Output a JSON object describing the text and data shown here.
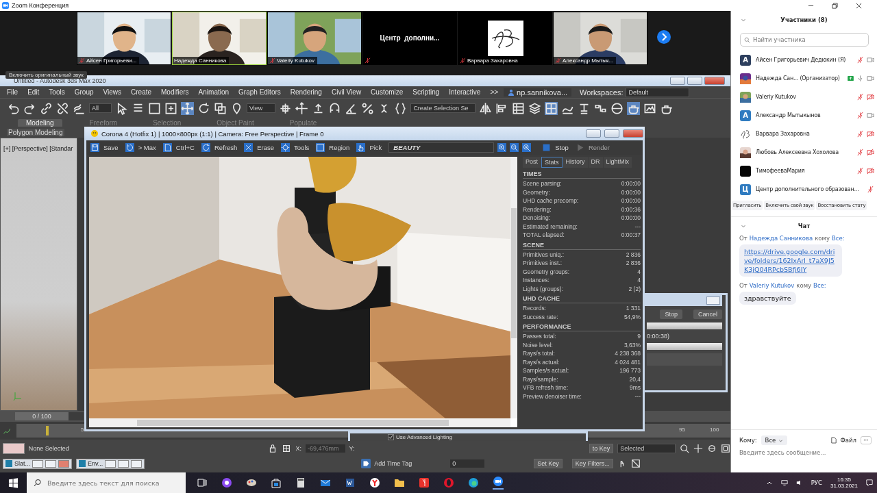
{
  "zoom_window": {
    "title": "Zoom Конференция"
  },
  "video_tiles": [
    {
      "name": "Айсен Григорьеви...",
      "kind": "video",
      "muted": true,
      "speaking": false
    },
    {
      "name": "Надежда Санникова",
      "kind": "video",
      "muted": false,
      "speaking": true
    },
    {
      "name": "Valeriy Kutukov",
      "kind": "video",
      "muted": true,
      "speaking": false
    },
    {
      "name": "Центр  дополни...",
      "kind": "name_only",
      "muted": true,
      "speaking": false
    },
    {
      "name": "Варвара Захаровна",
      "kind": "logo",
      "muted": true,
      "speaking": false
    },
    {
      "name": "Александр Мытык...",
      "kind": "video",
      "muted": true,
      "speaking": false
    }
  ],
  "original_sound_button": "Включить оригинальный звук",
  "max": {
    "title": "Untitled - Autodesk 3ds Max 2020",
    "menu": [
      "File",
      "Edit",
      "Tools",
      "Group",
      "Views",
      "Create",
      "Modifiers",
      "Animation",
      "Graph Editors",
      "Rendering",
      "Civil View",
      "Customize",
      "Scripting",
      "Interactive"
    ],
    "menu_overflow": ">>",
    "user": "np.sannikova...",
    "workspaces_label": "Workspaces:",
    "workspace": "Default",
    "selection_filter": "All",
    "reference_coord": "View",
    "selection_set": "Create Selection Se",
    "ribbon_tabs": [
      {
        "label": "Modeling",
        "selected": true
      },
      {
        "label": "Freeform",
        "selected": false
      },
      {
        "label": "Selection",
        "selected": false
      },
      {
        "label": "Object Paint",
        "selected": false
      },
      {
        "label": "Populate",
        "selected": false
      }
    ],
    "ribbon_panel": "Polygon Modeling",
    "viewport_label": "[+] [Perspective] [Standar",
    "time_slider": {
      "label": "0 / 100"
    },
    "ticks": [
      "5",
      "95",
      "100"
    ],
    "status": "None Selected",
    "x_label": "X:",
    "x_value": "-69,476mm",
    "y_label": "Y:",
    "auto_key": "to Key",
    "key_mode": "Selected",
    "set_key": "Set Key",
    "key_filters": "Key Filters...",
    "add_time_tag": "Add Time Tag",
    "frame": "0",
    "minimized": [
      "Slat...",
      "Env..."
    ]
  },
  "vfb": {
    "title": "Corona 4 (Hotfix 1) | 1000×800px (1:1) | Camera: Free Perspective | Frame 0",
    "toolbar": [
      "Save",
      "> Max",
      "Ctrl+C",
      "Refresh",
      "Erase",
      "Tools",
      "Region",
      "Pick"
    ],
    "channel": "BEAUTY",
    "stop": "Stop",
    "render": {
      "label": "Render",
      "disabled": true
    },
    "tabs": [
      {
        "label": "Post",
        "selected": false
      },
      {
        "label": "Stats",
        "selected": true
      },
      {
        "label": "History",
        "selected": false
      },
      {
        "label": "DR",
        "selected": false
      },
      {
        "label": "LightMix",
        "selected": false
      }
    ],
    "sections": [
      {
        "title": "TIMES",
        "rows": [
          {
            "label": "Scene parsing:",
            "value": "0:00:00"
          },
          {
            "label": "Geometry:",
            "value": "0:00:00"
          },
          {
            "label": "UHD cache precomp:",
            "value": "0:00:00"
          },
          {
            "label": "Rendering:",
            "value": "0:00:36"
          },
          {
            "label": "Denoising:",
            "value": "0:00:00"
          },
          {
            "label": "Estimated remaining:",
            "value": "---"
          },
          {
            "label": "TOTAL elapsed:",
            "value": "0:00:37"
          }
        ]
      },
      {
        "title": "SCENE",
        "rows": [
          {
            "label": "Primitives uniq.:",
            "value": "2 836"
          },
          {
            "label": "Primitives inst.:",
            "value": "2 836"
          },
          {
            "label": "Geometry groups:",
            "value": "4"
          },
          {
            "label": "Instances:",
            "value": "4"
          },
          {
            "label": "Lights (groups):",
            "value": "2 (2)"
          }
        ]
      },
      {
        "title": "UHD CACHE",
        "rows": [
          {
            "label": "Records:",
            "value": "1 331"
          },
          {
            "label": "Success rate:",
            "value": "54,9%"
          }
        ]
      },
      {
        "title": "PERFORMANCE",
        "rows": [
          {
            "label": "Passes total:",
            "value": "9"
          },
          {
            "label": "Noise level:",
            "value": "3,63%"
          },
          {
            "label": "Rays/s total:",
            "value": "4 238 368"
          },
          {
            "label": "Rays/s actual:",
            "value": "4 024 481"
          },
          {
            "label": "Samples/s actual:",
            "value": "196 773"
          },
          {
            "label": "Rays/sample:",
            "value": "20,4"
          },
          {
            "label": "VFB refresh time:",
            "value": "9ms"
          },
          {
            "label": "Preview denoiser time:",
            "value": "---"
          }
        ]
      }
    ]
  },
  "render_dialog": {
    "stop": "Stop",
    "cancel": "Cancel",
    "elapsed": "0:00:38)",
    "bars": [
      {
        "level": 1
      },
      {
        "level": 1
      }
    ]
  },
  "advanced_lighting": {
    "label": "Use Advanced Lighting",
    "checked": true
  },
  "participants": {
    "title": "Участники (8)",
    "search_placeholder": "Найти участника",
    "items": [
      {
        "name": "Айсен Григорьевич Дедюкин (Я)",
        "kind": "initial",
        "initial": "А",
        "color": "#2d3f5e",
        "muted": true,
        "video_off": false,
        "sharing": false
      },
      {
        "name": "Надежда Сан... (Организатор)",
        "kind": "picture",
        "muted": false,
        "video_off": false,
        "sharing": true
      },
      {
        "name": "Valeriy Kutukov",
        "kind": "picture",
        "muted": true,
        "video_off": true,
        "sharing": false
      },
      {
        "name": "Александр Мытыкынов",
        "kind": "initial",
        "initial": "А",
        "color": "#2f7bc0",
        "muted": true,
        "video_off": false,
        "sharing": false
      },
      {
        "name": "Варвара Захаровна",
        "kind": "logo",
        "muted": true,
        "video_off": true,
        "sharing": false
      },
      {
        "name": "Любовь Алексеевна Хохолова",
        "kind": "picture",
        "muted": true,
        "video_off": true,
        "sharing": false
      },
      {
        "name": "ТимофееваМария",
        "kind": "blank",
        "color": "#050505",
        "muted": true,
        "video_off": true,
        "sharing": false
      },
      {
        "name": "Центр дополнительного образован...",
        "kind": "initial",
        "initial": "Ц",
        "color": "#2f7bc0",
        "muted": true,
        "sharing": false
      }
    ],
    "buttons": [
      "Пригласить",
      "Включить свой звук",
      "Восстановить стату"
    ]
  },
  "chat": {
    "title": "Чат",
    "messages": [
      {
        "from_word": "От",
        "sender": "Надежда Санникова",
        "to_word": "кому",
        "recipient": "Все:",
        "kind": "link",
        "text": "https://drive.google.com/drive/folders/162IxArl_t7aX9J5K3jQ04RPcbSBfj6IY"
      },
      {
        "from_word": "От",
        "sender": "Valeriy Kutukov",
        "to_word": "кому",
        "recipient": "Все:",
        "kind": "text",
        "text": "здравствуйте"
      }
    ],
    "to_label": "Кому:",
    "to_value": "Все",
    "file": "Файл",
    "more": "···",
    "placeholder": "Введите здесь сообщение..."
  },
  "taskbar": {
    "search_placeholder": "Введите здесь текст для поиска",
    "language": "РУС",
    "time": "16:35",
    "date": "31.03.2021"
  }
}
